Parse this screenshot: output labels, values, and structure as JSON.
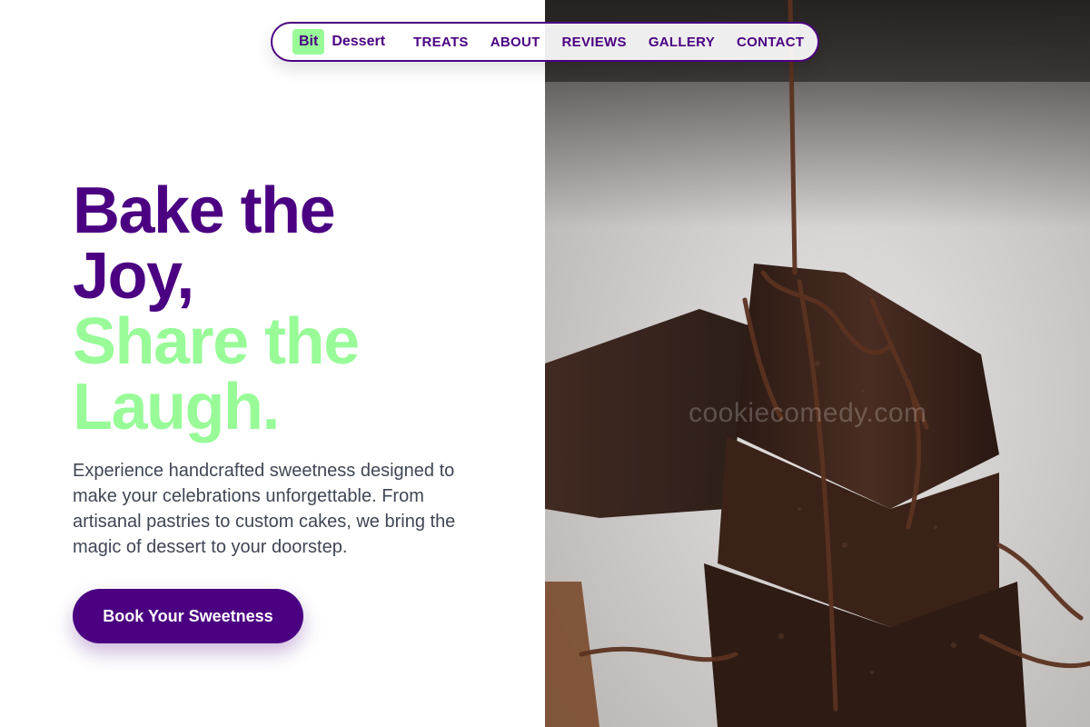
{
  "nav": {
    "logo_badge": "Bit",
    "logo_text": "Dessert",
    "items": [
      "TREATS",
      "ABOUT",
      "REVIEWS",
      "GALLERY",
      "CONTACT"
    ]
  },
  "hero": {
    "headline_line1": "Bake the",
    "headline_line2": "Joy,",
    "headline_line3": "Share the",
    "headline_line4": "Laugh.",
    "description": "Experience handcrafted sweetness designed to make your celebrations unforgettable. From artisanal pastries to custom cakes, we bring the magic of dessert to your doorstep.",
    "cta_label": "Book Your Sweetness"
  },
  "image": {
    "subject": "stacked chocolate brownies with chocolate drizzle",
    "watermark": "cookiecomedy.com"
  },
  "colors": {
    "primary": "#4b0082",
    "accent": "#98fb98",
    "text": "#3f4654",
    "background": "#ffffff"
  }
}
